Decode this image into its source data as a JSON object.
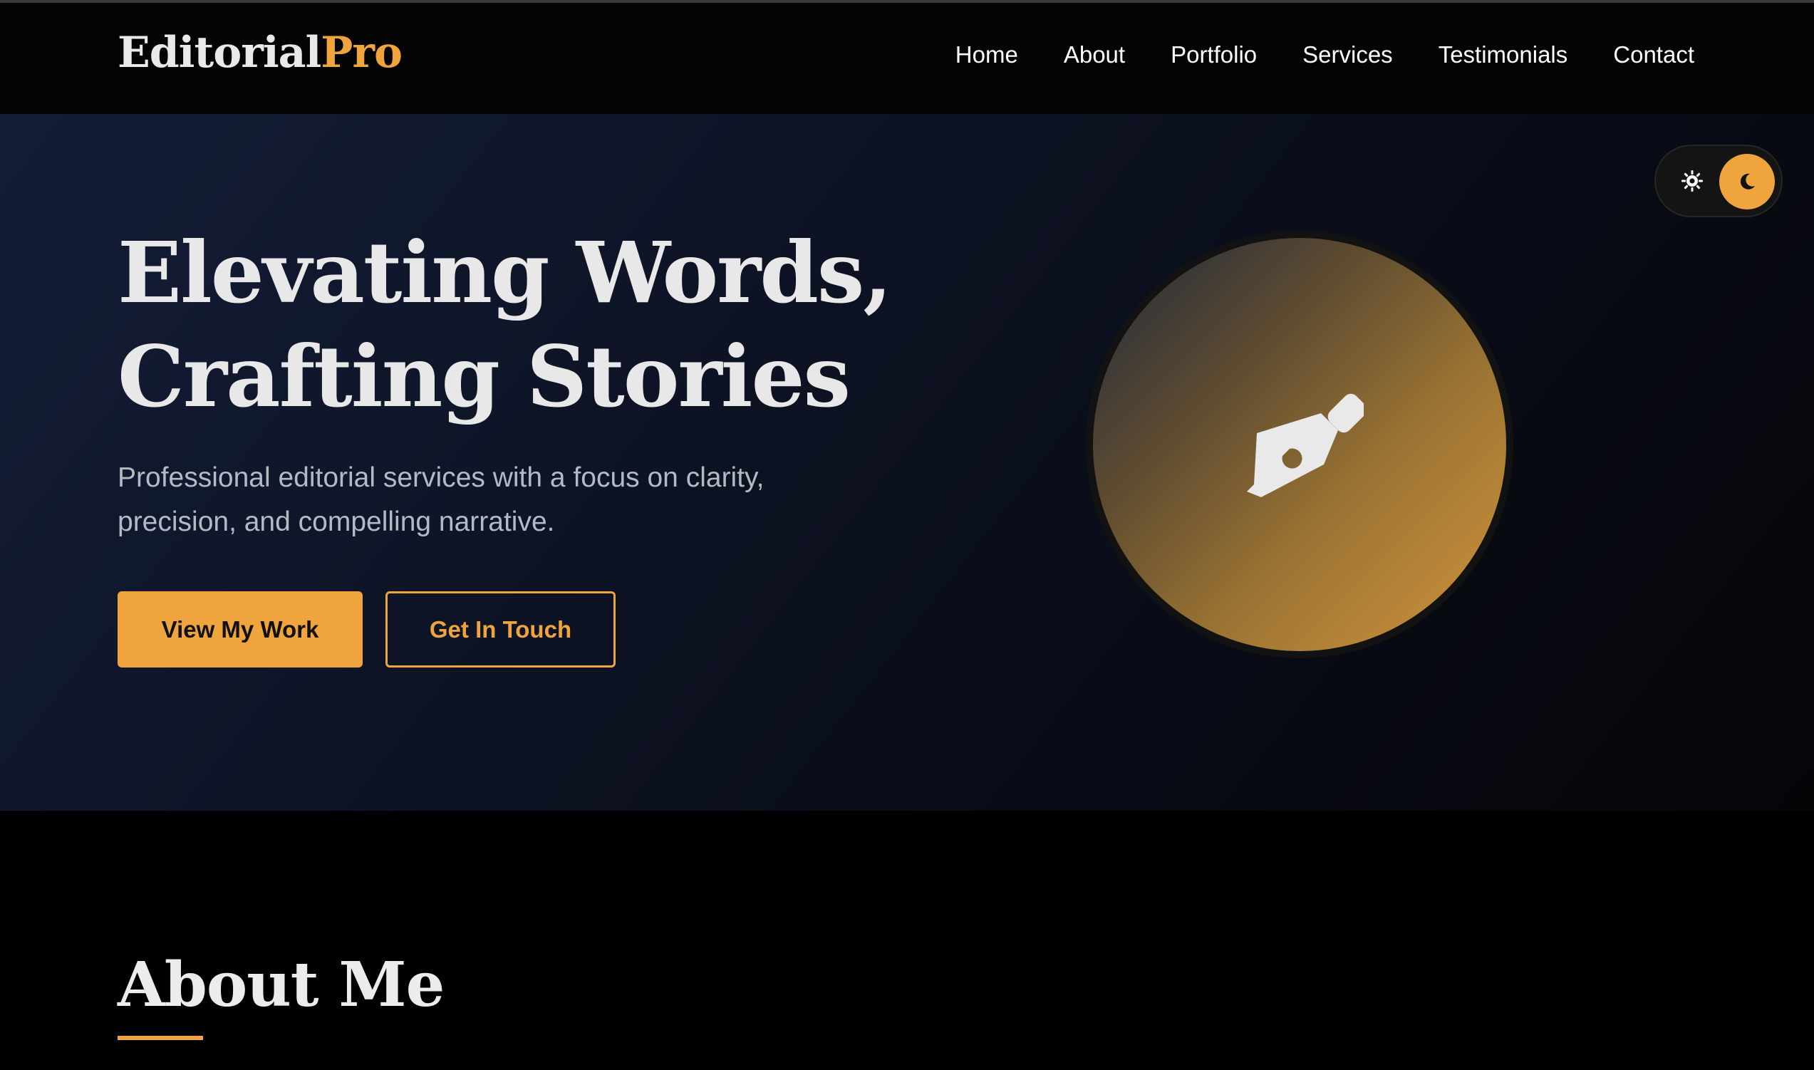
{
  "brand": {
    "name_main": "Editorial",
    "name_accent": "Pro"
  },
  "nav": {
    "items": [
      {
        "label": "Home"
      },
      {
        "label": "About"
      },
      {
        "label": "Portfolio"
      },
      {
        "label": "Services"
      },
      {
        "label": "Testimonials"
      },
      {
        "label": "Contact"
      }
    ]
  },
  "hero": {
    "title_line1": "Elevating Words,",
    "title_line2": "Crafting Stories",
    "subtitle": "Professional editorial services with a focus on clarity, precision, and compelling narrative.",
    "primary_button": "View My Work",
    "secondary_button": "Get In Touch",
    "icon": "fountain-pen-icon"
  },
  "theme_toggle": {
    "light_icon": "sun-icon",
    "dark_icon": "moon-icon",
    "active": "dark"
  },
  "about": {
    "title": "About Me"
  },
  "colors": {
    "accent": "#f0a43d",
    "header_bg": "#040404",
    "hero_text": "#e8e8e8",
    "hero_subtext": "#b5b9c4",
    "page_bg": "#000000"
  }
}
